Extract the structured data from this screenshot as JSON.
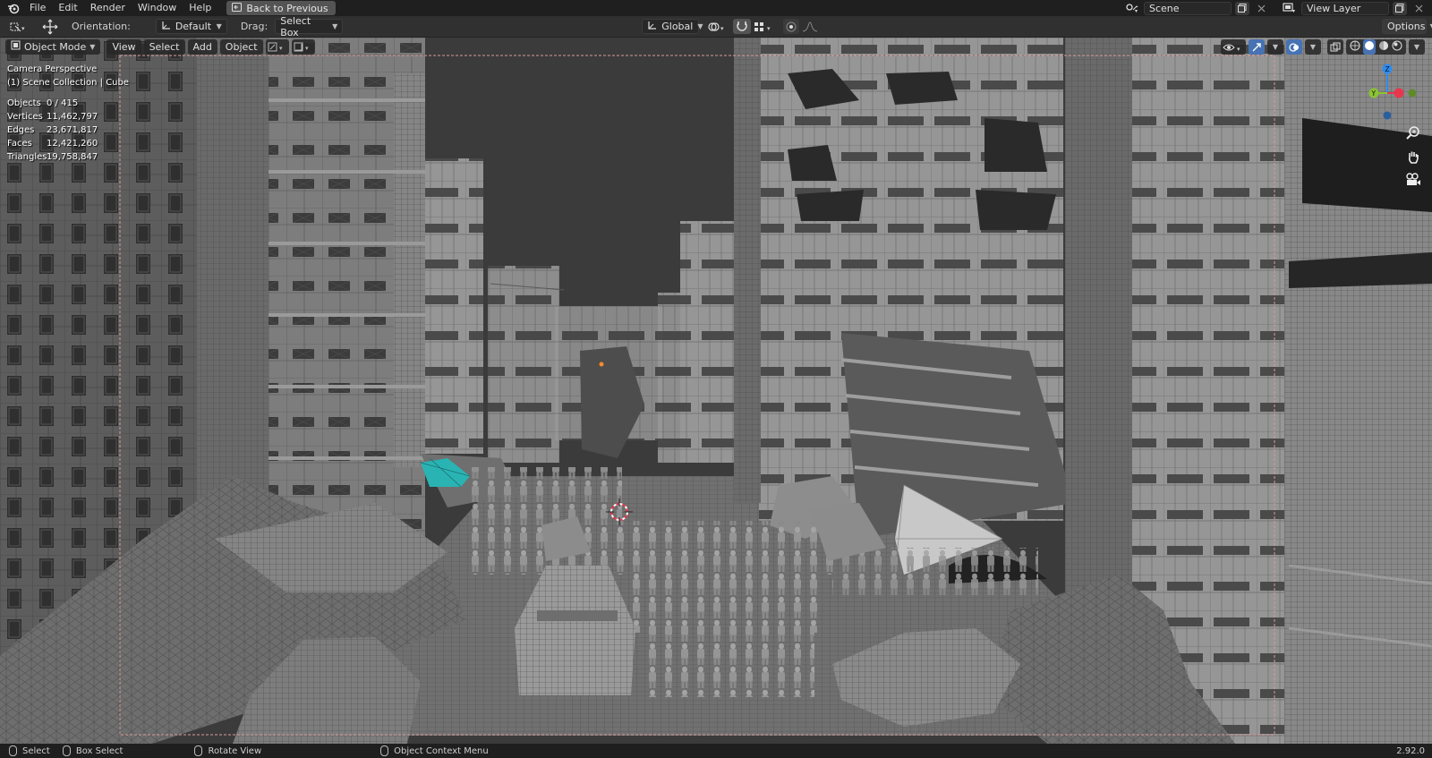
{
  "menu": {
    "items": [
      "File",
      "Edit",
      "Render",
      "Window",
      "Help"
    ],
    "back_button": "Back to Previous"
  },
  "topright": {
    "scene_value": "Scene",
    "view_layer_value": "View Layer"
  },
  "tool_header": {
    "orientation_label": "Orientation:",
    "orientation_value": "Default",
    "drag_label": "Drag:",
    "drag_value": "Select Box",
    "transform_orientation": "Global",
    "options_label": "Options"
  },
  "viewport_header": {
    "mode": "Object Mode",
    "menus": [
      "View",
      "Select",
      "Add",
      "Object"
    ]
  },
  "overlay": {
    "view_name": "Camera Perspective",
    "collection": "(1) Scene Collection | Cube"
  },
  "stats": [
    {
      "label": "Objects",
      "value": "0 / 415"
    },
    {
      "label": "Vertices",
      "value": "11,462,797"
    },
    {
      "label": "Edges",
      "value": "23,671,817"
    },
    {
      "label": "Faces",
      "value": "12,421,260"
    },
    {
      "label": "Triangles",
      "value": "19,758,847"
    }
  ],
  "statusbar": {
    "select": "Select",
    "box_select": "Box Select",
    "rotate_view": "Rotate View",
    "context_menu": "Object Context Menu",
    "version": "2.92.0"
  },
  "colors": {
    "accent": "#4772b3",
    "axis_x": "#e8364e",
    "axis_y": "#8bc532",
    "axis_z": "#2d8cf0",
    "sky": "#3a3a3a",
    "selected_car": "#2ab3b3"
  },
  "icons": {
    "logo": "blender-logo-icon",
    "back": "back-icon",
    "scene": "scene-icon",
    "view_layer": "view-layer-icon",
    "cursor": "3d-cursor-icon"
  }
}
